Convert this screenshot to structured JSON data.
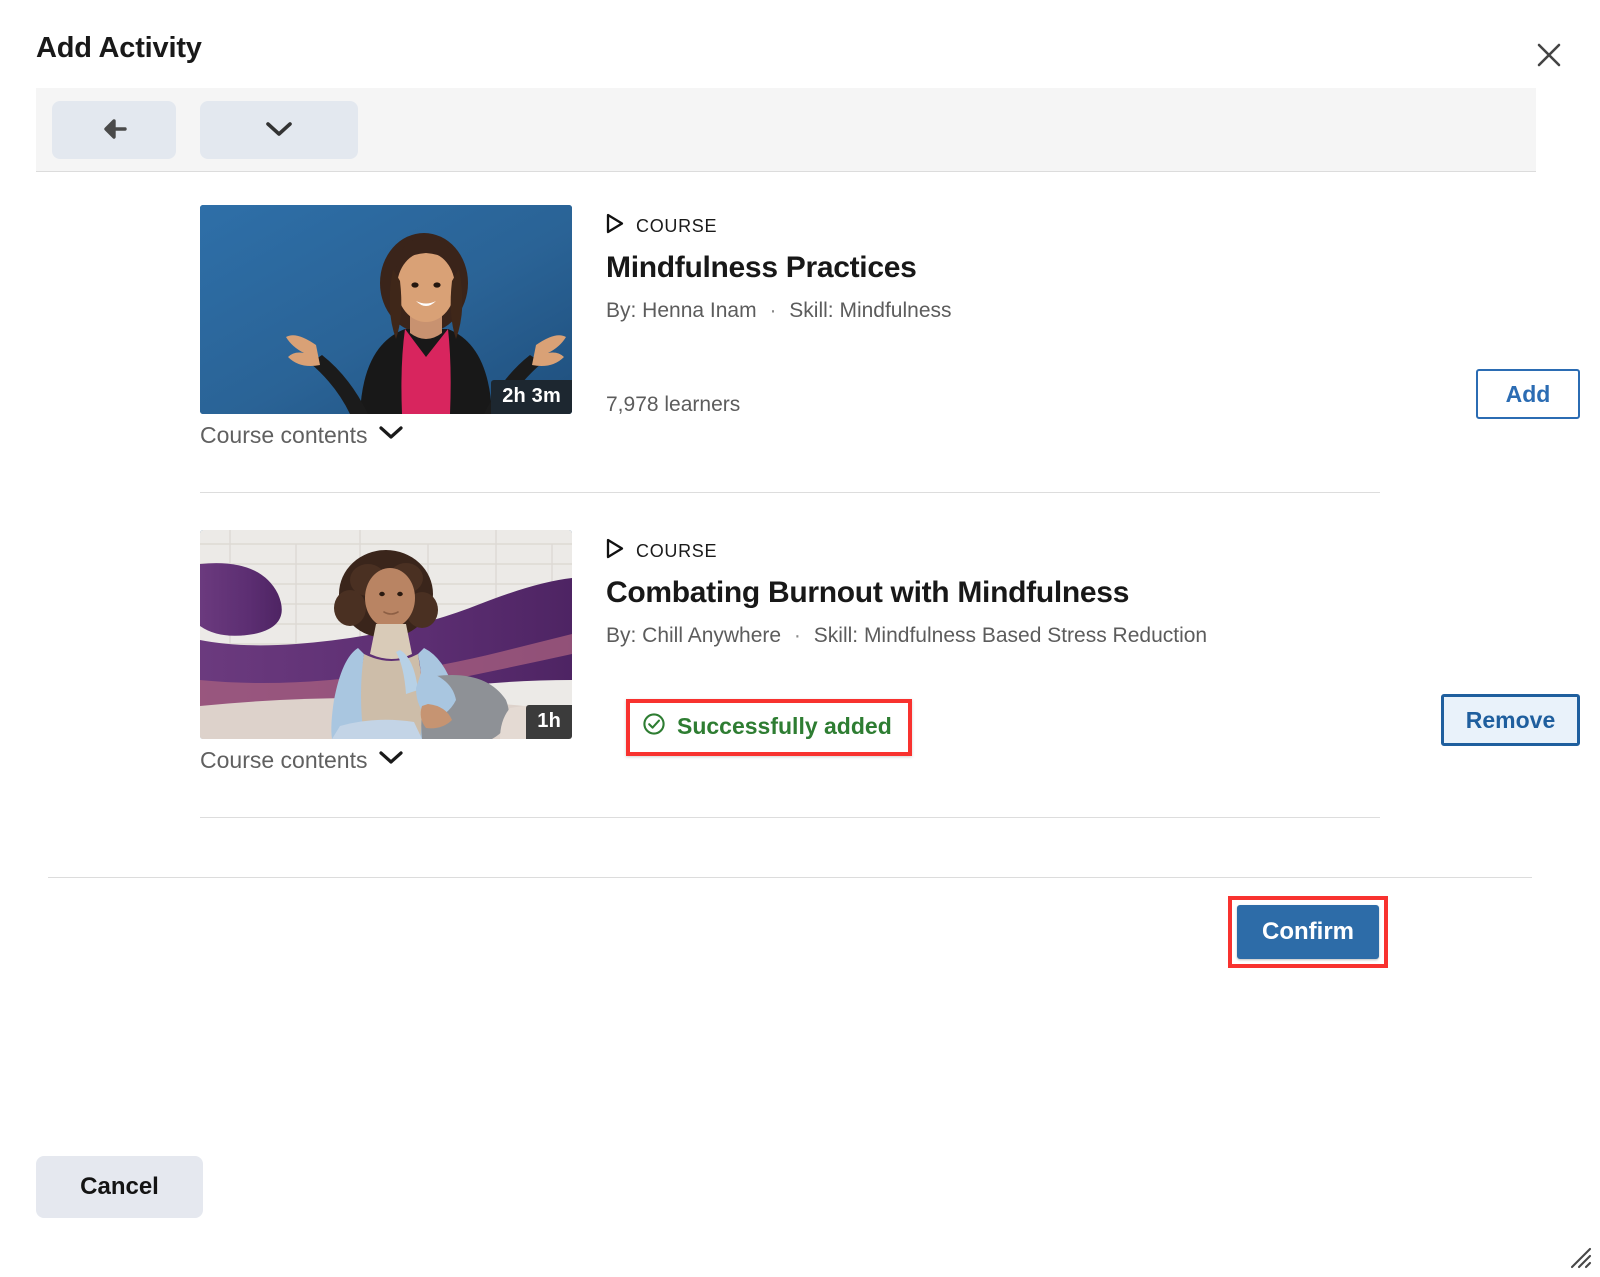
{
  "dialog": {
    "title": "Add Activity",
    "close_icon": "close-icon"
  },
  "toolbar": {
    "back_icon": "arrow-left-icon",
    "expand_icon": "chevron-down-icon"
  },
  "courses": [
    {
      "kicker": "COURSE",
      "kicker_icon": "play-triangle-icon",
      "title": "Mindfulness Practices",
      "byline": "By: Henna Inam",
      "separator": "·",
      "skill": "Skill: Mindfulness",
      "duration": "2h 3m",
      "contents_label": "Course contents",
      "contents_icon": "chevron-down-icon",
      "learners": "7,978 learners",
      "action_label": "Add",
      "action_state": "add"
    },
    {
      "kicker": "COURSE",
      "kicker_icon": "play-triangle-icon",
      "title": "Combating Burnout with Mindfulness",
      "byline": "By: Chill Anywhere",
      "separator": "·",
      "skill": "Skill: Mindfulness Based Stress Reduction",
      "duration": "1h",
      "contents_label": "Course contents",
      "contents_icon": "chevron-down-icon",
      "learners": "",
      "status_text": "Successfully added",
      "status_icon": "check-circle-icon",
      "action_label": "Remove",
      "action_state": "remove"
    }
  ],
  "footer": {
    "confirm_label": "Confirm",
    "cancel_label": "Cancel",
    "resize_icon": "resize-grip-icon"
  },
  "colors": {
    "accent_blue": "#2b6cb3",
    "confirm_blue": "#2d6ca8",
    "success_green": "#2e7d32",
    "highlight_red": "#f8322f",
    "toolbar_gray": "#f5f5f5",
    "button_gray": "#e5e8ef",
    "badge_dark": "#1d2730"
  }
}
